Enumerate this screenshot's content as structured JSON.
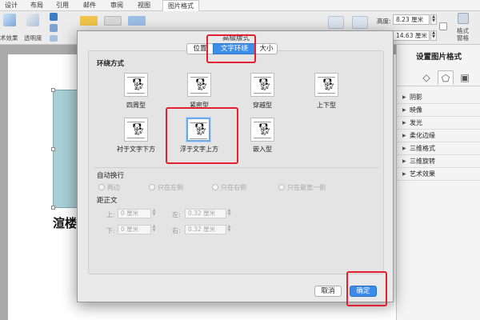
{
  "ribbon": {
    "tabs": [
      "设计",
      "布局",
      "引用",
      "邮件",
      "审阅",
      "视图",
      "图片格式"
    ],
    "active_tab": "图片格式",
    "effects_label": "术效果",
    "transparency_label": "透明度",
    "height_label": "高度:",
    "height_value": "8.23 厘米",
    "width_value": "14.63 厘米",
    "format_pane_label_1": "格式",
    "format_pane_label_2": "窗格"
  },
  "document": {
    "text": "渲楼"
  },
  "format_pane": {
    "title": "设置图片格式",
    "sections": [
      "阴影",
      "映像",
      "发光",
      "柔化边缘",
      "三维格式",
      "三维旋转",
      "艺术效果"
    ]
  },
  "dialog": {
    "title": "高级版式",
    "tabs": [
      "位置",
      "文字环绕",
      "大小"
    ],
    "active_tab": "文字环绕",
    "wrap_section_title": "环绕方式",
    "wrap_options": [
      "四周型",
      "紧密型",
      "穿越型",
      "上下型",
      "衬于文字下方",
      "浮于文字上方",
      "嵌入型"
    ],
    "selected_wrap": "浮于文字上方",
    "auto_wrap_title": "自动换行",
    "auto_wrap_options": [
      "两边",
      "只在左侧",
      "只在右侧",
      "只在最宽一侧"
    ],
    "distance_title": "距正文",
    "distance": {
      "top_label": "上:",
      "top_value": "0 厘米",
      "left_label": "左:",
      "left_value": "0.32 厘米",
      "bottom_label": "下:",
      "bottom_value": "0 厘米",
      "right_label": "右:",
      "right_value": "0.32 厘米"
    },
    "cancel_label": "取消",
    "ok_label": "确定"
  },
  "colors": {
    "accent": "#3a8bea",
    "highlight": "#e32030"
  }
}
